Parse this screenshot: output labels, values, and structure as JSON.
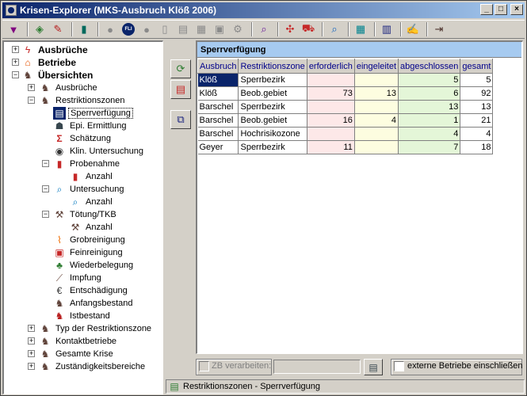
{
  "window": {
    "title": "Krisen-Explorer  (MKS-Ausbruch Klöß 2006)",
    "controls": [
      "_",
      "□",
      "×"
    ]
  },
  "toolbar": {
    "icons": [
      "filter-icon",
      "open-icon",
      "edit-icon",
      "book-icon",
      "globe-gray-icon",
      "globe-fli-icon",
      "globe-gray-icon",
      "document-icon",
      "document-lines-icon",
      "document-w-icon",
      "document-plus-icon",
      "document-gear-icon",
      "magnifier-icon",
      "network-icon",
      "car-icon",
      "magnifier-doc-icon",
      "calculator-icon",
      "clipboard-icon",
      "notepad-icon",
      "exit-icon"
    ],
    "fli_label": "FLI"
  },
  "tree": {
    "nodes": [
      {
        "label": "Ausbrüche",
        "bold": true,
        "icon": "lightning-icon",
        "exp": "+"
      },
      {
        "label": "Betriebe",
        "bold": true,
        "icon": "house-icon",
        "exp": "+"
      },
      {
        "label": "Übersichten",
        "bold": true,
        "icon": "cows-icon",
        "exp": "−"
      },
      {
        "label": "Ausbrüche",
        "icon": "cows-icon",
        "exp": "+"
      },
      {
        "label": "Restriktionszonen",
        "icon": "cows-icon",
        "exp": "−"
      },
      {
        "label": "Sperrverfügung",
        "icon": "document-icon",
        "selected": true
      },
      {
        "label": "Epi. Ermittlung",
        "icon": "detective-icon"
      },
      {
        "label": "Schätzung",
        "icon": "sigma-icon"
      },
      {
        "label": "Klin. Untersuchung",
        "icon": "eye-icon"
      },
      {
        "label": "Probenahme",
        "icon": "test-tube-icon",
        "exp": "−"
      },
      {
        "label": "Anzahl",
        "icon": "test-tube-icon"
      },
      {
        "label": "Untersuchung",
        "icon": "magnifier-icon",
        "exp": "−"
      },
      {
        "label": "Anzahl",
        "icon": "magnifier-icon"
      },
      {
        "label": "Tötung/TKB",
        "icon": "hammer-icon",
        "exp": "−"
      },
      {
        "label": "Anzahl",
        "icon": "hammer-icon"
      },
      {
        "label": "Grobreinigung",
        "icon": "broom-icon"
      },
      {
        "label": "Feinreinigung",
        "icon": "spray-icon"
      },
      {
        "label": "Wiederbelegung",
        "icon": "tree-icon"
      },
      {
        "label": "Impfung",
        "icon": "syringe-icon"
      },
      {
        "label": "Entschädigung",
        "icon": "money-icon"
      },
      {
        "label": "Anfangsbestand",
        "icon": "cows-icon"
      },
      {
        "label": "Istbestand",
        "icon": "cow-red-icon"
      },
      {
        "label": "Typ der Restriktionszone",
        "icon": "cows-icon",
        "exp": "+"
      },
      {
        "label": "Kontaktbetriebe",
        "icon": "cows-icon",
        "exp": "+"
      },
      {
        "label": "Gesamte Krise",
        "icon": "cows-icon",
        "exp": "+"
      },
      {
        "label": "Zuständigkeitsbereiche",
        "icon": "cows-icon",
        "exp": "+"
      }
    ]
  },
  "sidebuttons": [
    "refresh-icon",
    "print-icon",
    "copy-icon"
  ],
  "grid": {
    "caption": "Sperrverfügung",
    "columns": [
      "Ausbruch",
      "Restriktionszone",
      "erforderlich",
      "eingeleitet",
      "abgeschlossen",
      "gesamt"
    ],
    "rows": [
      [
        "Klöß",
        "Sperrbezirk",
        "",
        "",
        "5",
        "5"
      ],
      [
        "Klöß",
        "Beob.gebiet",
        "73",
        "13",
        "6",
        "92"
      ],
      [
        "Barschel",
        "Sperrbezirk",
        "",
        "",
        "13",
        "13"
      ],
      [
        "Barschel",
        "Beob.gebiet",
        "16",
        "4",
        "1",
        "21"
      ],
      [
        "Barschel",
        "Hochrisikozone",
        "",
        "",
        "4",
        "4"
      ],
      [
        "Geyer",
        "Sperrbezirk",
        "11",
        "",
        "7",
        "18"
      ]
    ]
  },
  "bottom": {
    "zb_label": "ZB verarbeiten:",
    "zb_value": "",
    "extern_label": "externe Betriebe einschließen"
  },
  "status": {
    "text": "Restriktionszonen - Sperrverfügung"
  },
  "colors": {
    "titlebar_start": "#0a246a",
    "titlebar_end": "#a6caf0",
    "caption_bg": "#a6caf0",
    "erforderlich_bg": "#fde8e8",
    "eingeleitet_bg": "#fdfde0",
    "abgeschlossen_bg": "#e4f6d8"
  }
}
